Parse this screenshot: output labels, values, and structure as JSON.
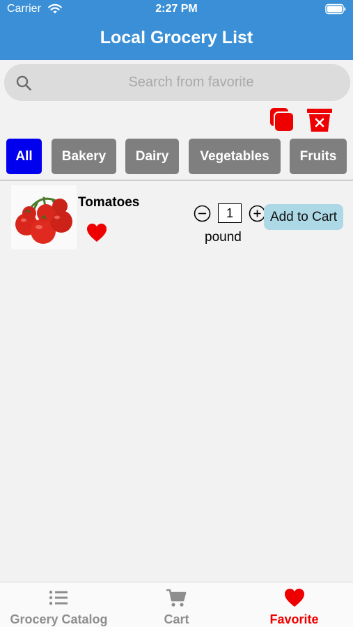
{
  "status_bar": {
    "carrier": "Carrier",
    "time": "2:27 PM"
  },
  "header": {
    "title": "Local Grocery List"
  },
  "search": {
    "placeholder": "Search from favorite",
    "value": ""
  },
  "toolbar": {
    "copy_icon": "copy-icon",
    "delete_icon": "trash-delete-icon"
  },
  "categories": [
    {
      "label": "All",
      "active": true
    },
    {
      "label": "Bakery",
      "active": false
    },
    {
      "label": "Dairy",
      "active": false
    },
    {
      "label": "Vegetables",
      "active": false
    },
    {
      "label": "Fruits",
      "active": false
    }
  ],
  "items": [
    {
      "name": "Tomatoes",
      "favorite": true,
      "quantity": "1",
      "unit": "pound",
      "add_label": "Add to Cart"
    }
  ],
  "tabs": [
    {
      "label": "Grocery Catalog",
      "icon": "list-icon",
      "active": false
    },
    {
      "label": "Cart",
      "icon": "cart-icon",
      "active": false
    },
    {
      "label": "Favorite",
      "icon": "heart-icon",
      "active": true
    }
  ],
  "colors": {
    "header": "#3a8fd6",
    "category_active": "#0000ee",
    "category_inactive": "#7f7f7f",
    "accent_red": "#ee0000",
    "add_button": "#add8e6"
  }
}
